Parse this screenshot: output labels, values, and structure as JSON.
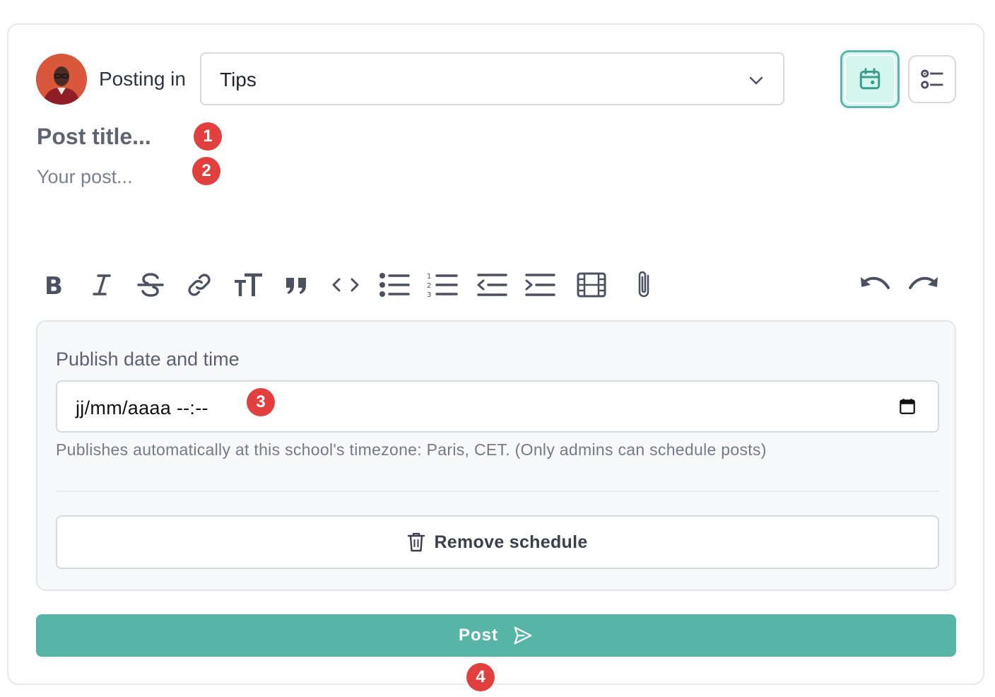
{
  "composer": {
    "posting_in_label": "Posting in",
    "category_select": {
      "selected": "Tips"
    },
    "title_placeholder": "Post title...",
    "body_placeholder": "Your post..."
  },
  "header_buttons": {
    "schedule": {
      "icon": "calendar-icon",
      "active": true
    },
    "checklist": {
      "icon": "checklist-icon",
      "active": false
    }
  },
  "toolbar": {
    "formatting": [
      "bold-icon",
      "italic-icon",
      "strikethrough-icon",
      "link-icon",
      "text-size-icon",
      "quote-icon",
      "code-icon",
      "bullet-list-icon",
      "numbered-list-icon",
      "outdent-icon",
      "indent-icon",
      "video-icon",
      "attachment-icon"
    ],
    "history": [
      "undo-icon",
      "redo-icon"
    ]
  },
  "schedule": {
    "label": "Publish date and time",
    "datetime_value": "jj/mm/aaaa --:--",
    "hint": "Publishes automatically at this school's timezone: Paris, CET. (Only admins can schedule posts)",
    "remove_label": "Remove schedule"
  },
  "submit": {
    "label": "Post"
  },
  "markers": [
    "1",
    "2",
    "3",
    "4"
  ],
  "colors": {
    "accent": "#56b5a7",
    "accent_light": "#d5f5ef",
    "marker": "#e2403f",
    "avatar_bg": "#d9573a"
  }
}
